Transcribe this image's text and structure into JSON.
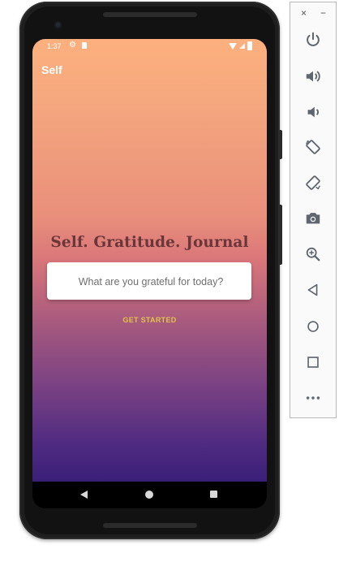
{
  "status_bar": {
    "time": "1:37"
  },
  "app": {
    "title": "Self",
    "headline": "Self. Gratitude. Journal",
    "input_placeholder": "What are you grateful for today?",
    "cta_label": "GET STARTED"
  },
  "emulator_panel": {
    "close_label": "×",
    "minimize_label": "−",
    "tools": [
      "power-icon",
      "volume-up-icon",
      "volume-down-icon",
      "rotate-left-icon",
      "rotate-right-icon",
      "camera-icon",
      "zoom-icon",
      "back-icon",
      "home-icon",
      "overview-icon",
      "more-icon"
    ]
  },
  "colors": {
    "gradient_top": "#fdb07e",
    "gradient_bottom": "#3a1f78",
    "headline": "#6a3639",
    "cta": "#e1c14a",
    "panel_icon": "#5f6670"
  }
}
